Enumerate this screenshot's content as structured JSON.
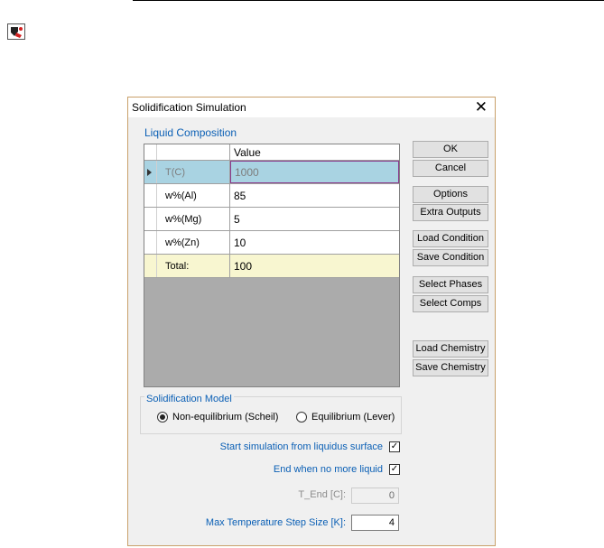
{
  "window_title": "Solidification Simulation",
  "close_glyph": "✕",
  "liquid_composition": {
    "title": "Liquid Composition",
    "column_header": "Value",
    "rows": [
      {
        "name": "T(C)",
        "value": "1000"
      },
      {
        "name": "w%(Al)",
        "value": "85"
      },
      {
        "name": "w%(Mg)",
        "value": "5"
      },
      {
        "name": "w%(Zn)",
        "value": "10"
      },
      {
        "name": "Total:",
        "value": "100"
      }
    ]
  },
  "buttons": {
    "ok": "OK",
    "cancel": "Cancel",
    "options": "Options",
    "extra_outputs": "Extra Outputs",
    "load_condition": "Load Condition",
    "save_condition": "Save Condition",
    "select_phases": "Select Phases",
    "select_comps": "Select Comps",
    "load_chemistry": "Load Chemistry",
    "save_chemistry": "Save Chemistry"
  },
  "solidification_model": {
    "title": "Solidification Model",
    "options": [
      "Non-equilibrium (Scheil)",
      "Equilibrium (Lever)"
    ],
    "selected": "Non-equilibrium (Scheil)"
  },
  "options": {
    "start_from_liquidus": {
      "label": "Start simulation from liquidus surface",
      "checked": true
    },
    "end_when_no_liquid": {
      "label": "End when no more liquid",
      "checked": true
    },
    "t_end": {
      "label": "T_End [C]:",
      "value": "0"
    },
    "max_step": {
      "label": "Max Temperature Step Size [K]:",
      "value": "4"
    }
  },
  "colors": {
    "accent": "#0a5fb5",
    "selected_row": "#a9d3e2",
    "total_row": "#f8f6d0"
  }
}
